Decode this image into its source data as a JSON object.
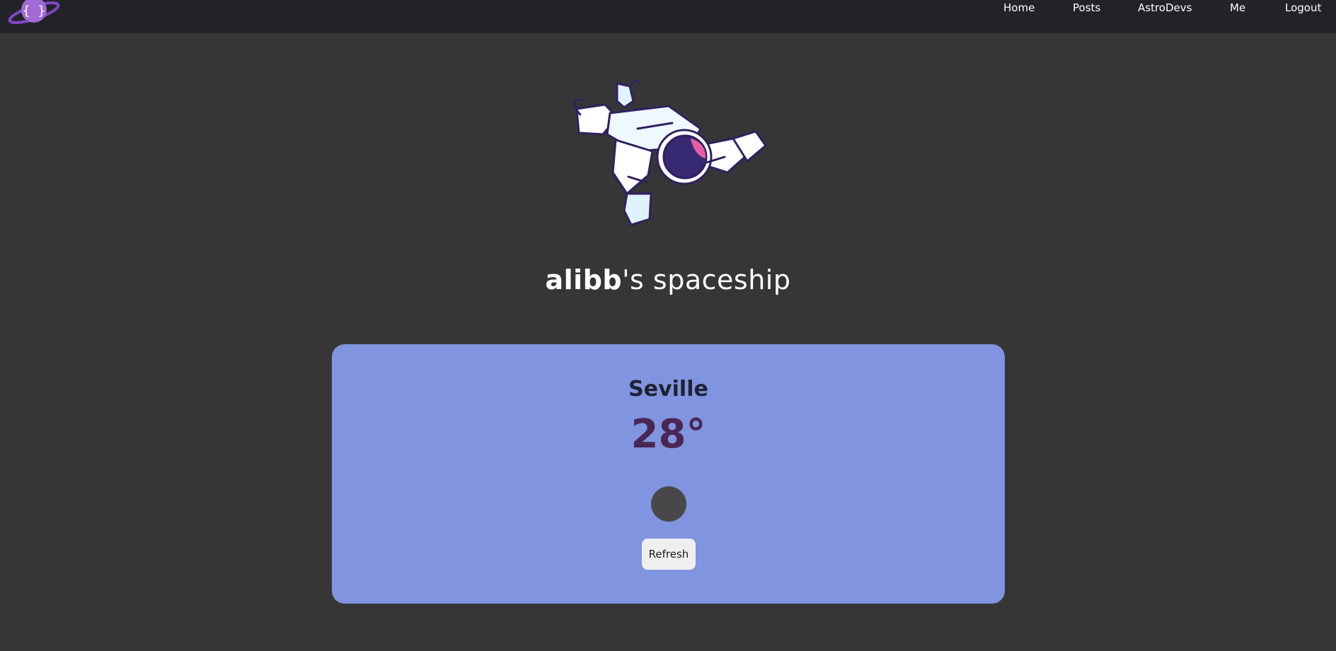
{
  "nav": {
    "logo_text": "{ }",
    "links": [
      {
        "label": "Home"
      },
      {
        "label": "Posts"
      },
      {
        "label": "AstroDevs"
      },
      {
        "label": "Me"
      },
      {
        "label": "Logout"
      }
    ]
  },
  "hero": {
    "username": "alibb",
    "title_suffix": "'s spaceship"
  },
  "weather": {
    "city": "Seville",
    "temperature": "28°",
    "icon": "weather-condition-icon",
    "refresh_label": "Refresh"
  },
  "colors": {
    "background": "#363636",
    "navbar": "#212327",
    "card": "#8194df",
    "temperature": "#4a2653",
    "logo_purple": "#8e5bc7"
  }
}
